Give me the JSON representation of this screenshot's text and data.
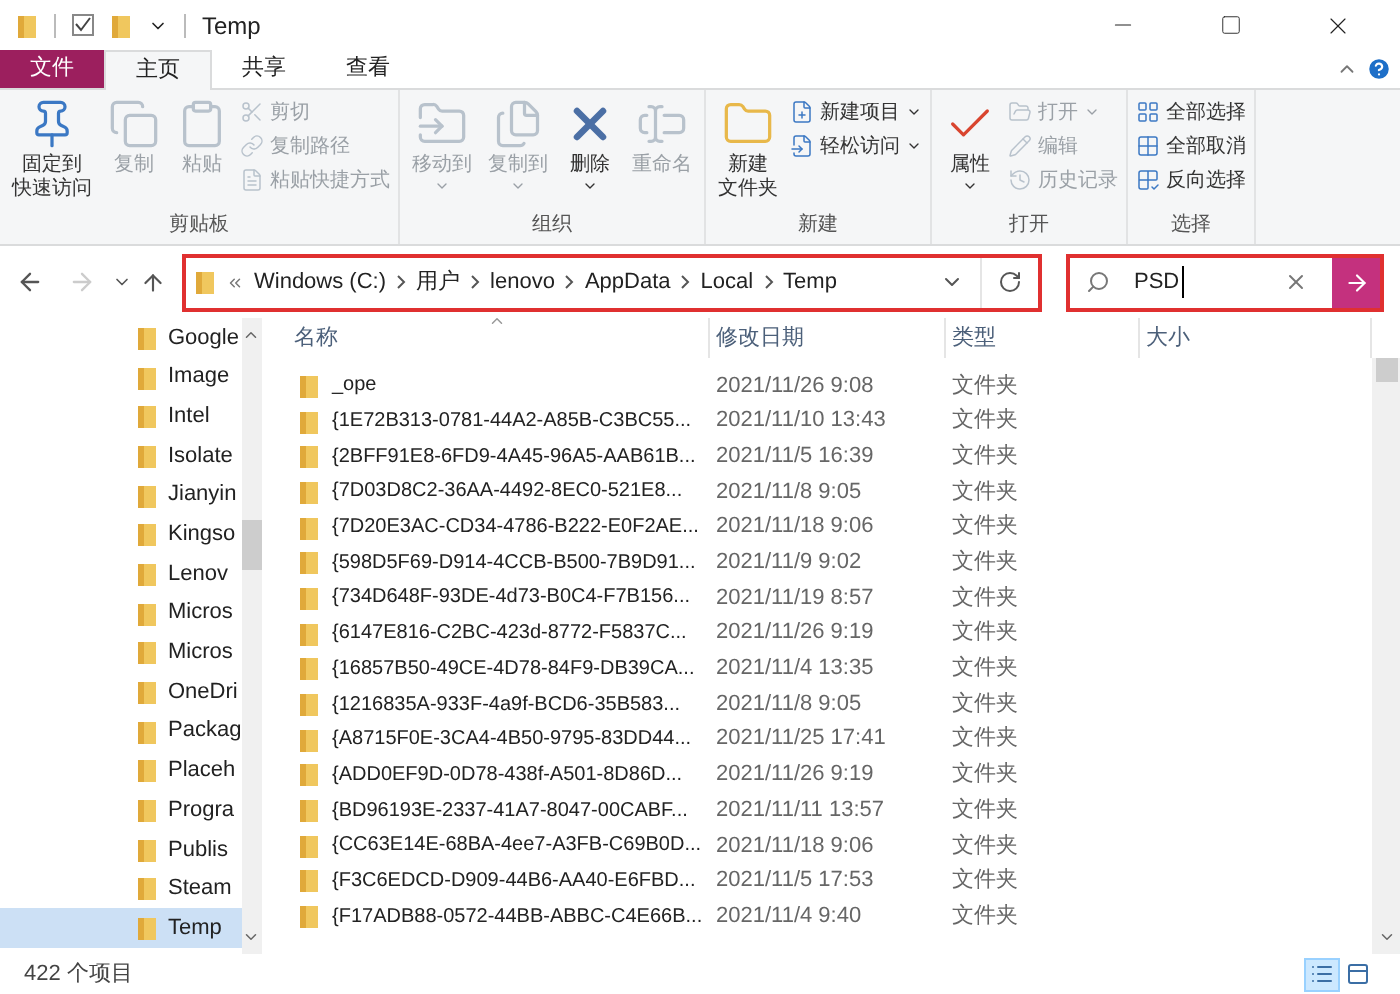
{
  "window": {
    "title": "Temp"
  },
  "ribbon": {
    "tabs": [
      {
        "label": "文件",
        "kind": "file",
        "selected": false
      },
      {
        "label": "主页",
        "kind": "tab",
        "selected": true
      },
      {
        "label": "共享",
        "kind": "tab",
        "selected": false
      },
      {
        "label": "查看",
        "kind": "tab",
        "selected": false
      }
    ],
    "groups": [
      {
        "label": "剪贴板",
        "large": [
          {
            "lines": [
              "固定到",
              "快速访问"
            ],
            "disabled": false,
            "dropdown": false
          },
          {
            "lines": [
              "复制"
            ],
            "disabled": true,
            "dropdown": false
          },
          {
            "lines": [
              "粘贴"
            ],
            "disabled": true,
            "dropdown": false
          }
        ],
        "small": [
          {
            "label": "剪切",
            "disabled": true,
            "dropdown": false
          },
          {
            "label": "复制路径",
            "disabled": true,
            "dropdown": false
          },
          {
            "label": "粘贴快捷方式",
            "disabled": true,
            "dropdown": false
          }
        ]
      },
      {
        "label": "组织",
        "large": [
          {
            "lines": [
              "移动到"
            ],
            "disabled": true,
            "dropdown": true
          },
          {
            "lines": [
              "复制到"
            ],
            "disabled": true,
            "dropdown": true
          },
          {
            "lines": [
              "删除"
            ],
            "disabled": false,
            "dropdown": true
          },
          {
            "lines": [
              "重命名"
            ],
            "disabled": true,
            "dropdown": false
          }
        ]
      },
      {
        "label": "新建",
        "large": [
          {
            "lines": [
              "新建",
              "文件夹"
            ],
            "disabled": false,
            "dropdown": false
          }
        ],
        "small": [
          {
            "label": "新建项目",
            "disabled": false,
            "dropdown": true
          },
          {
            "label": "轻松访问",
            "disabled": false,
            "dropdown": true
          }
        ]
      },
      {
        "label": "打开",
        "large": [
          {
            "lines": [
              "属性"
            ],
            "disabled": false,
            "dropdown": true
          }
        ],
        "small": [
          {
            "label": "打开",
            "disabled": true,
            "dropdown": true
          },
          {
            "label": "编辑",
            "disabled": true,
            "dropdown": false
          },
          {
            "label": "历史记录",
            "disabled": true,
            "dropdown": false
          }
        ]
      },
      {
        "label": "选择",
        "small": [
          {
            "label": "全部选择",
            "disabled": false,
            "dropdown": false
          },
          {
            "label": "全部取消",
            "disabled": false,
            "dropdown": false
          },
          {
            "label": "反向选择",
            "disabled": false,
            "dropdown": false
          }
        ]
      }
    ]
  },
  "nav": {
    "back_disabled": false,
    "forward_disabled": true
  },
  "address_bar": {
    "highlighted": true,
    "crumbs": [
      "Windows (C:)",
      "用户",
      "lenovo",
      "AppData",
      "Local",
      "Temp"
    ]
  },
  "search": {
    "highlighted": true,
    "value": "PSD"
  },
  "sidebar": {
    "items": [
      {
        "label": "Google",
        "selected": false
      },
      {
        "label": "Image",
        "selected": false
      },
      {
        "label": "Intel",
        "selected": false
      },
      {
        "label": "Isolate",
        "selected": false
      },
      {
        "label": "Jianyin",
        "selected": false
      },
      {
        "label": "Kingso",
        "selected": false
      },
      {
        "label": "Lenov",
        "selected": false
      },
      {
        "label": "Micros",
        "selected": false
      },
      {
        "label": "Micros",
        "selected": false
      },
      {
        "label": "OneDri",
        "selected": false
      },
      {
        "label": "Packag",
        "selected": false
      },
      {
        "label": "Placeh",
        "selected": false
      },
      {
        "label": "Progra",
        "selected": false
      },
      {
        "label": "Publis",
        "selected": false
      },
      {
        "label": "Steam",
        "selected": false
      },
      {
        "label": "Temp",
        "selected": true
      }
    ]
  },
  "table": {
    "columns": [
      "名称",
      "修改日期",
      "类型",
      "大小"
    ],
    "rows": [
      [
        "_ope",
        "2021/11/26 9:08",
        "文件夹"
      ],
      [
        "{1E72B313-0781-44A2-A85B-C3BC55...",
        "2021/11/10 13:43",
        "文件夹"
      ],
      [
        "{2BFF91E8-6FD9-4A45-96A5-AAB61B...",
        "2021/11/5 16:39",
        "文件夹"
      ],
      [
        "{7D03D8C2-36AA-4492-8EC0-521E8...",
        "2021/11/8 9:05",
        "文件夹"
      ],
      [
        "{7D20E3AC-CD34-4786-B222-E0F2AE...",
        "2021/11/18 9:06",
        "文件夹"
      ],
      [
        "{598D5F69-D914-4CCB-B500-7B9D91...",
        "2021/11/9 9:02",
        "文件夹"
      ],
      [
        "{734D648F-93DE-4d73-B0C4-F7B156...",
        "2021/11/19 8:57",
        "文件夹"
      ],
      [
        "{6147E816-C2BC-423d-8772-F5837C...",
        "2021/11/26 9:19",
        "文件夹"
      ],
      [
        "{16857B50-49CE-4D78-84F9-DB39CA...",
        "2021/11/4 13:35",
        "文件夹"
      ],
      [
        "{1216835A-933F-4a9f-BCD6-35B583...",
        "2021/11/8 9:05",
        "文件夹"
      ],
      [
        "{A8715F0E-3CA4-4B50-9795-83DD44...",
        "2021/11/25 17:41",
        "文件夹"
      ],
      [
        "{ADD0EF9D-0D78-438f-A501-8D86D...",
        "2021/11/26 9:19",
        "文件夹"
      ],
      [
        "{BD96193E-2337-41A7-8047-00CABF...",
        "2021/11/11 13:57",
        "文件夹"
      ],
      [
        "{CC63E14E-68BA-4ee7-A3FB-C69B0D...",
        "2021/11/18 9:06",
        "文件夹"
      ],
      [
        "{F3C6EDCD-D909-44B6-AA40-E6FBD...",
        "2021/11/5 17:53",
        "文件夹"
      ],
      [
        "{F17ADB88-0572-44BB-ABBC-C4E66B...",
        "2021/11/4 9:40",
        "文件夹"
      ]
    ]
  },
  "status_bar": {
    "text": "422 个项目",
    "views": [
      {
        "kind": "details",
        "selected": true
      },
      {
        "kind": "tiles",
        "selected": false
      }
    ]
  }
}
